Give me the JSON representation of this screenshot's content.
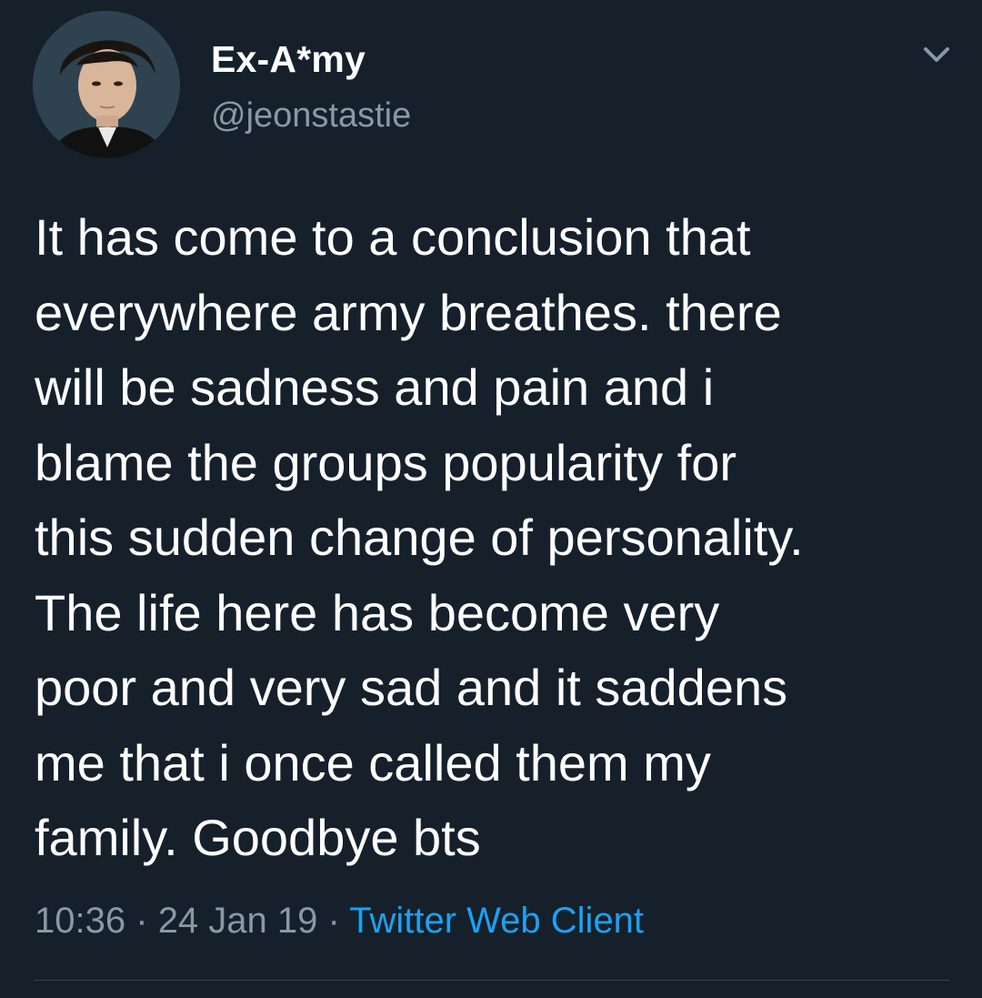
{
  "author": {
    "display_name": "Ex-A*my",
    "handle": "@jeonstastie",
    "avatar_icon": "profile-photo"
  },
  "menu": {
    "icon": "chevron-down-icon"
  },
  "tweet": {
    "text": "It has come to a conclusion that\neverywhere army breathes. there\nwill be sadness and pain and i\nblame the groups popularity for\nthis sudden change of personality.\nThe life here has become very\npoor and very sad and it saddens\nme that i once called them my\nfamily. Goodbye bts"
  },
  "meta": {
    "time": "10:36",
    "separator_1": "·",
    "date": "24 Jan 19",
    "separator_2": "·",
    "source": "Twitter Web Client"
  },
  "colors": {
    "background": "#15202b",
    "primary_text": "#ffffff",
    "secondary_text": "#8899a6",
    "link": "#1da1f2",
    "divider": "#38444d"
  }
}
